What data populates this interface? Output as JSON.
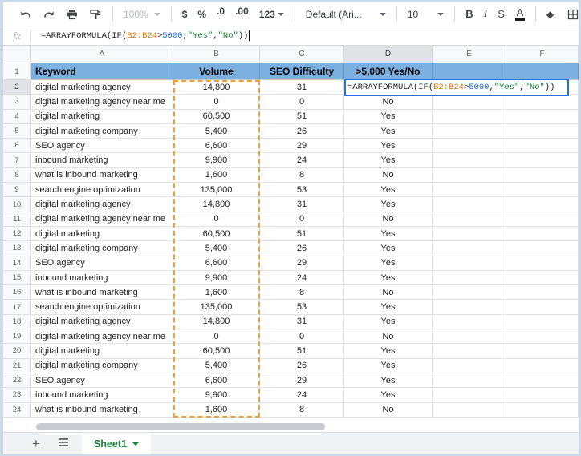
{
  "selection": {
    "active_cell": "D2",
    "referenced_range": "B2:B24",
    "active_column": "D",
    "active_row": "2"
  },
  "toolbar": {
    "zoom_label": "100%",
    "currency_label": "$",
    "percent_label": "%",
    "decrease_decimal_label": ".0",
    "decrease_decimal_arrow": "←",
    "increase_decimal_label": ".00",
    "increase_decimal_arrow": "→",
    "more_formats_label": "123",
    "font_name_label": "Default (Ari...",
    "font_size_label": "10",
    "bold_label": "B",
    "italic_label": "I",
    "strikethrough_label": "S",
    "text_color_label": "A",
    "fill_color_glyph": "◆."
  },
  "formula_bar": {
    "fx_label": "fx"
  },
  "formula": {
    "part_open": "=ARRAYFORMULA(IF(",
    "range_ref": "B2:B24",
    "operator": ">",
    "threshold": "5000",
    "separator": ", ",
    "value_if_true": "\"Yes\"",
    "comma": ",",
    "value_if_false": "\"No\"",
    "part_close": "))"
  },
  "grid": {
    "column_letters": [
      "A",
      "B",
      "C",
      "D",
      "E",
      "F"
    ],
    "headers": {
      "keyword": "Keyword",
      "volume": "Volume",
      "difficulty": "SEO Difficulty",
      "yesno": ">5,000 Yes/No"
    },
    "rows": [
      {
        "num": "2",
        "keyword": "digital marketing agency",
        "volume": "14,800",
        "difficulty": "31",
        "yesno": ""
      },
      {
        "num": "3",
        "keyword": "digital marketing agency near me",
        "volume": "0",
        "difficulty": "0",
        "yesno": "No"
      },
      {
        "num": "4",
        "keyword": "digital marketing",
        "volume": "60,500",
        "difficulty": "51",
        "yesno": "Yes"
      },
      {
        "num": "5",
        "keyword": "digital marketing company",
        "volume": "5,400",
        "difficulty": "26",
        "yesno": "Yes"
      },
      {
        "num": "6",
        "keyword": "SEO agency",
        "volume": "6,600",
        "difficulty": "29",
        "yesno": "Yes"
      },
      {
        "num": "7",
        "keyword": "inbound marketing",
        "volume": "9,900",
        "difficulty": "24",
        "yesno": "Yes"
      },
      {
        "num": "8",
        "keyword": "what is inbound marketing",
        "volume": "1,600",
        "difficulty": "8",
        "yesno": "No"
      },
      {
        "num": "9",
        "keyword": "search engine optimization",
        "volume": "135,000",
        "difficulty": "53",
        "yesno": "Yes"
      },
      {
        "num": "10",
        "keyword": "digital marketing agency",
        "volume": "14,800",
        "difficulty": "31",
        "yesno": "Yes"
      },
      {
        "num": "11",
        "keyword": "digital marketing agency near me",
        "volume": "0",
        "difficulty": "0",
        "yesno": "No"
      },
      {
        "num": "12",
        "keyword": "digital marketing",
        "volume": "60,500",
        "difficulty": "51",
        "yesno": "Yes"
      },
      {
        "num": "13",
        "keyword": "digital marketing company",
        "volume": "5,400",
        "difficulty": "26",
        "yesno": "Yes"
      },
      {
        "num": "14",
        "keyword": "SEO agency",
        "volume": "6,600",
        "difficulty": "29",
        "yesno": "Yes"
      },
      {
        "num": "15",
        "keyword": "inbound marketing",
        "volume": "9,900",
        "difficulty": "24",
        "yesno": "Yes"
      },
      {
        "num": "16",
        "keyword": "what is inbound marketing",
        "volume": "1,600",
        "difficulty": "8",
        "yesno": "No"
      },
      {
        "num": "17",
        "keyword": "search engine optimization",
        "volume": "135,000",
        "difficulty": "53",
        "yesno": "Yes"
      },
      {
        "num": "18",
        "keyword": "digital marketing agency",
        "volume": "14,800",
        "difficulty": "31",
        "yesno": "Yes"
      },
      {
        "num": "19",
        "keyword": "digital marketing agency near me",
        "volume": "0",
        "difficulty": "0",
        "yesno": "No"
      },
      {
        "num": "20",
        "keyword": "digital marketing",
        "volume": "60,500",
        "difficulty": "51",
        "yesno": "Yes"
      },
      {
        "num": "21",
        "keyword": "digital marketing company",
        "volume": "5,400",
        "difficulty": "26",
        "yesno": "Yes"
      },
      {
        "num": "22",
        "keyword": "SEO agency",
        "volume": "6,600",
        "difficulty": "29",
        "yesno": "Yes"
      },
      {
        "num": "23",
        "keyword": "inbound marketing",
        "volume": "9,900",
        "difficulty": "24",
        "yesno": "Yes"
      },
      {
        "num": "24",
        "keyword": "what is inbound marketing",
        "volume": "1,600",
        "difficulty": "8",
        "yesno": "No"
      }
    ]
  },
  "sheet_bar": {
    "tab_label": "Sheet1"
  },
  "icons": {
    "undo-icon": "curved-left-arrow",
    "redo-icon": "curved-right-arrow",
    "print-icon": "printer",
    "paint-format-icon": "paint-roller",
    "fill-color-icon": "paint-bucket-diamond",
    "borders-icon": "grid-4-pane",
    "merge-cells-icon": "merge-arrows (disabled)",
    "add-sheet-icon": "plus",
    "all-sheets-icon": "hamburger-list",
    "sheet-menu-icon": "chevron-down"
  },
  "colors": {
    "header_row_bg": "#7cb0e0",
    "range_highlight_border": "#e9a23b",
    "active_cell_border": "#1a73e8",
    "formula_range_token": "#e8710a",
    "formula_number_token": "#1967d2",
    "formula_string_token": "#188038",
    "sheet_tab_green": "#188038"
  }
}
